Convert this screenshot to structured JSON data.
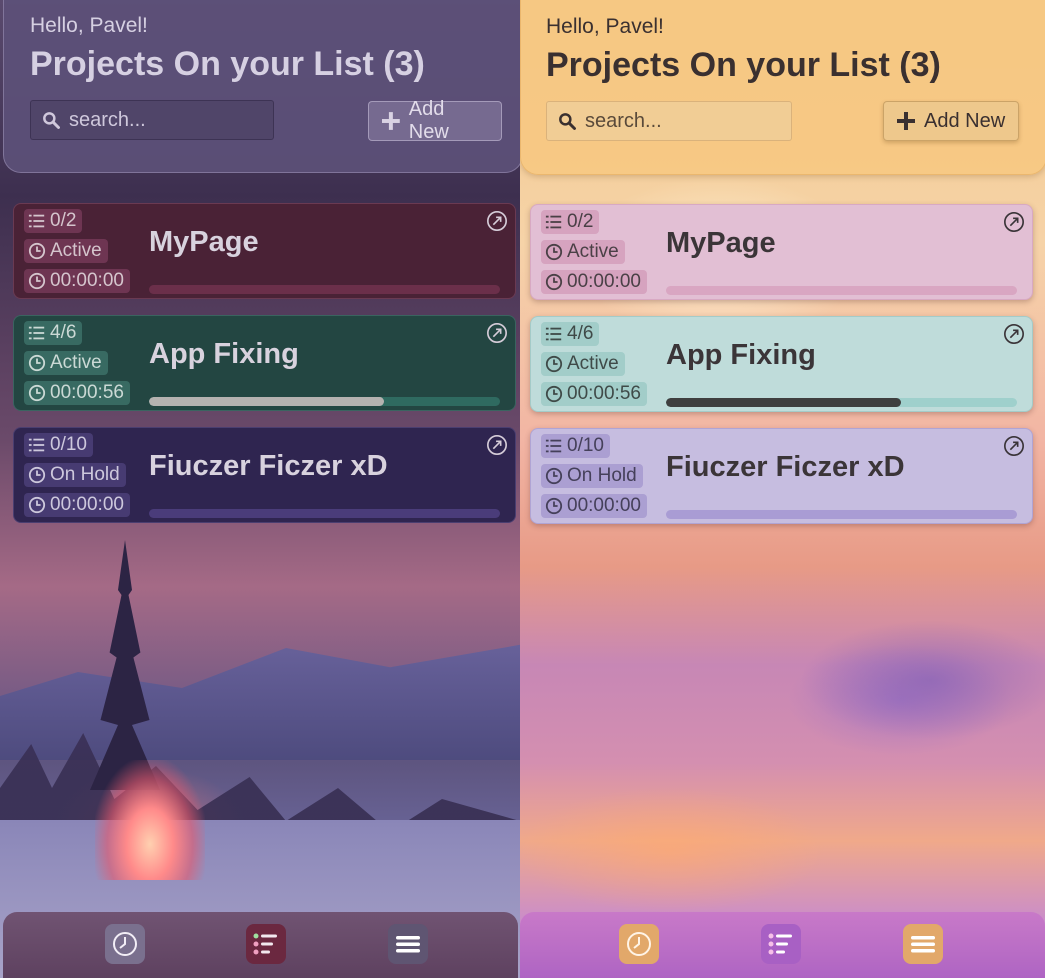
{
  "screens": [
    {
      "theme": "dark",
      "greeting": "Hello, Pavel!",
      "title": "Projects On your List (3)",
      "search_placeholder": "search...",
      "add_label": "Add New",
      "projects": [
        {
          "tasks": "0/2",
          "status": "Active",
          "time": "00:00:00",
          "name": "MyPage",
          "progress": 0
        },
        {
          "tasks": "4/6",
          "status": "Active",
          "time": "00:00:56",
          "name": "App Fixing",
          "progress": 0.67
        },
        {
          "tasks": "0/10",
          "status": "On Hold",
          "time": "00:00:00",
          "name": "Fiuczer Ficzer xD",
          "progress": 0
        }
      ],
      "nav": [
        "clock-icon",
        "task-list-icon",
        "menu-icon"
      ]
    },
    {
      "theme": "light",
      "greeting": "Hello, Pavel!",
      "title": "Projects On your List (3)",
      "search_placeholder": "search...",
      "add_label": "Add New",
      "projects": [
        {
          "tasks": "0/2",
          "status": "Active",
          "time": "00:00:00",
          "name": "MyPage",
          "progress": 0
        },
        {
          "tasks": "4/6",
          "status": "Active",
          "time": "00:00:56",
          "name": "App Fixing",
          "progress": 0.67
        },
        {
          "tasks": "0/10",
          "status": "On Hold",
          "time": "00:00:00",
          "name": "Fiuczer Ficzer xD",
          "progress": 0
        }
      ],
      "nav": [
        "clock-icon",
        "task-list-icon",
        "menu-icon"
      ]
    }
  ]
}
